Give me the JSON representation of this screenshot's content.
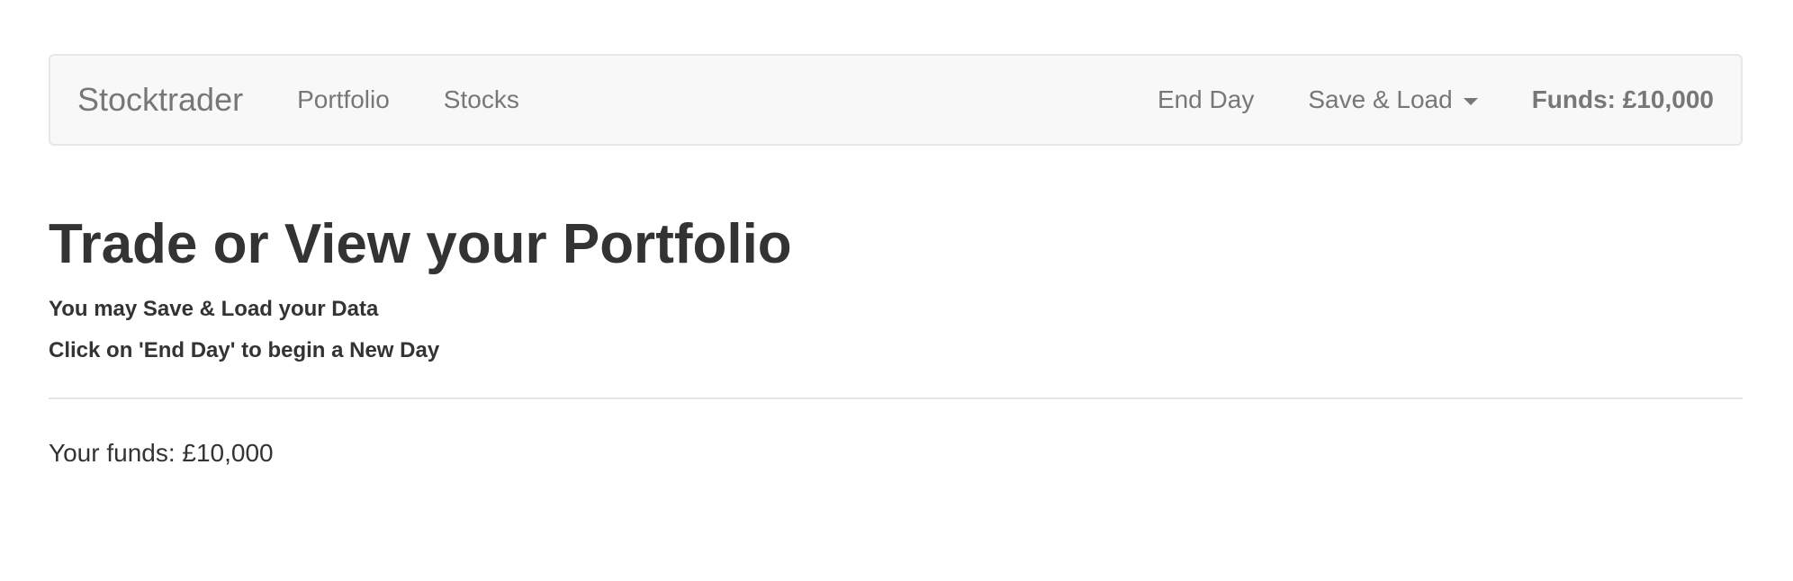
{
  "navbar": {
    "brand": "Stocktrader",
    "left_links": [
      "Portfolio",
      "Stocks"
    ],
    "end_day": "End Day",
    "save_load": "Save & Load",
    "funds": "Funds: £10,000"
  },
  "main": {
    "title": "Trade or View your Portfolio",
    "subtitle_1": "You may Save & Load your Data",
    "subtitle_2": "Click on 'End Day' to begin a New Day",
    "funds_text": "Your funds: £10,000"
  }
}
